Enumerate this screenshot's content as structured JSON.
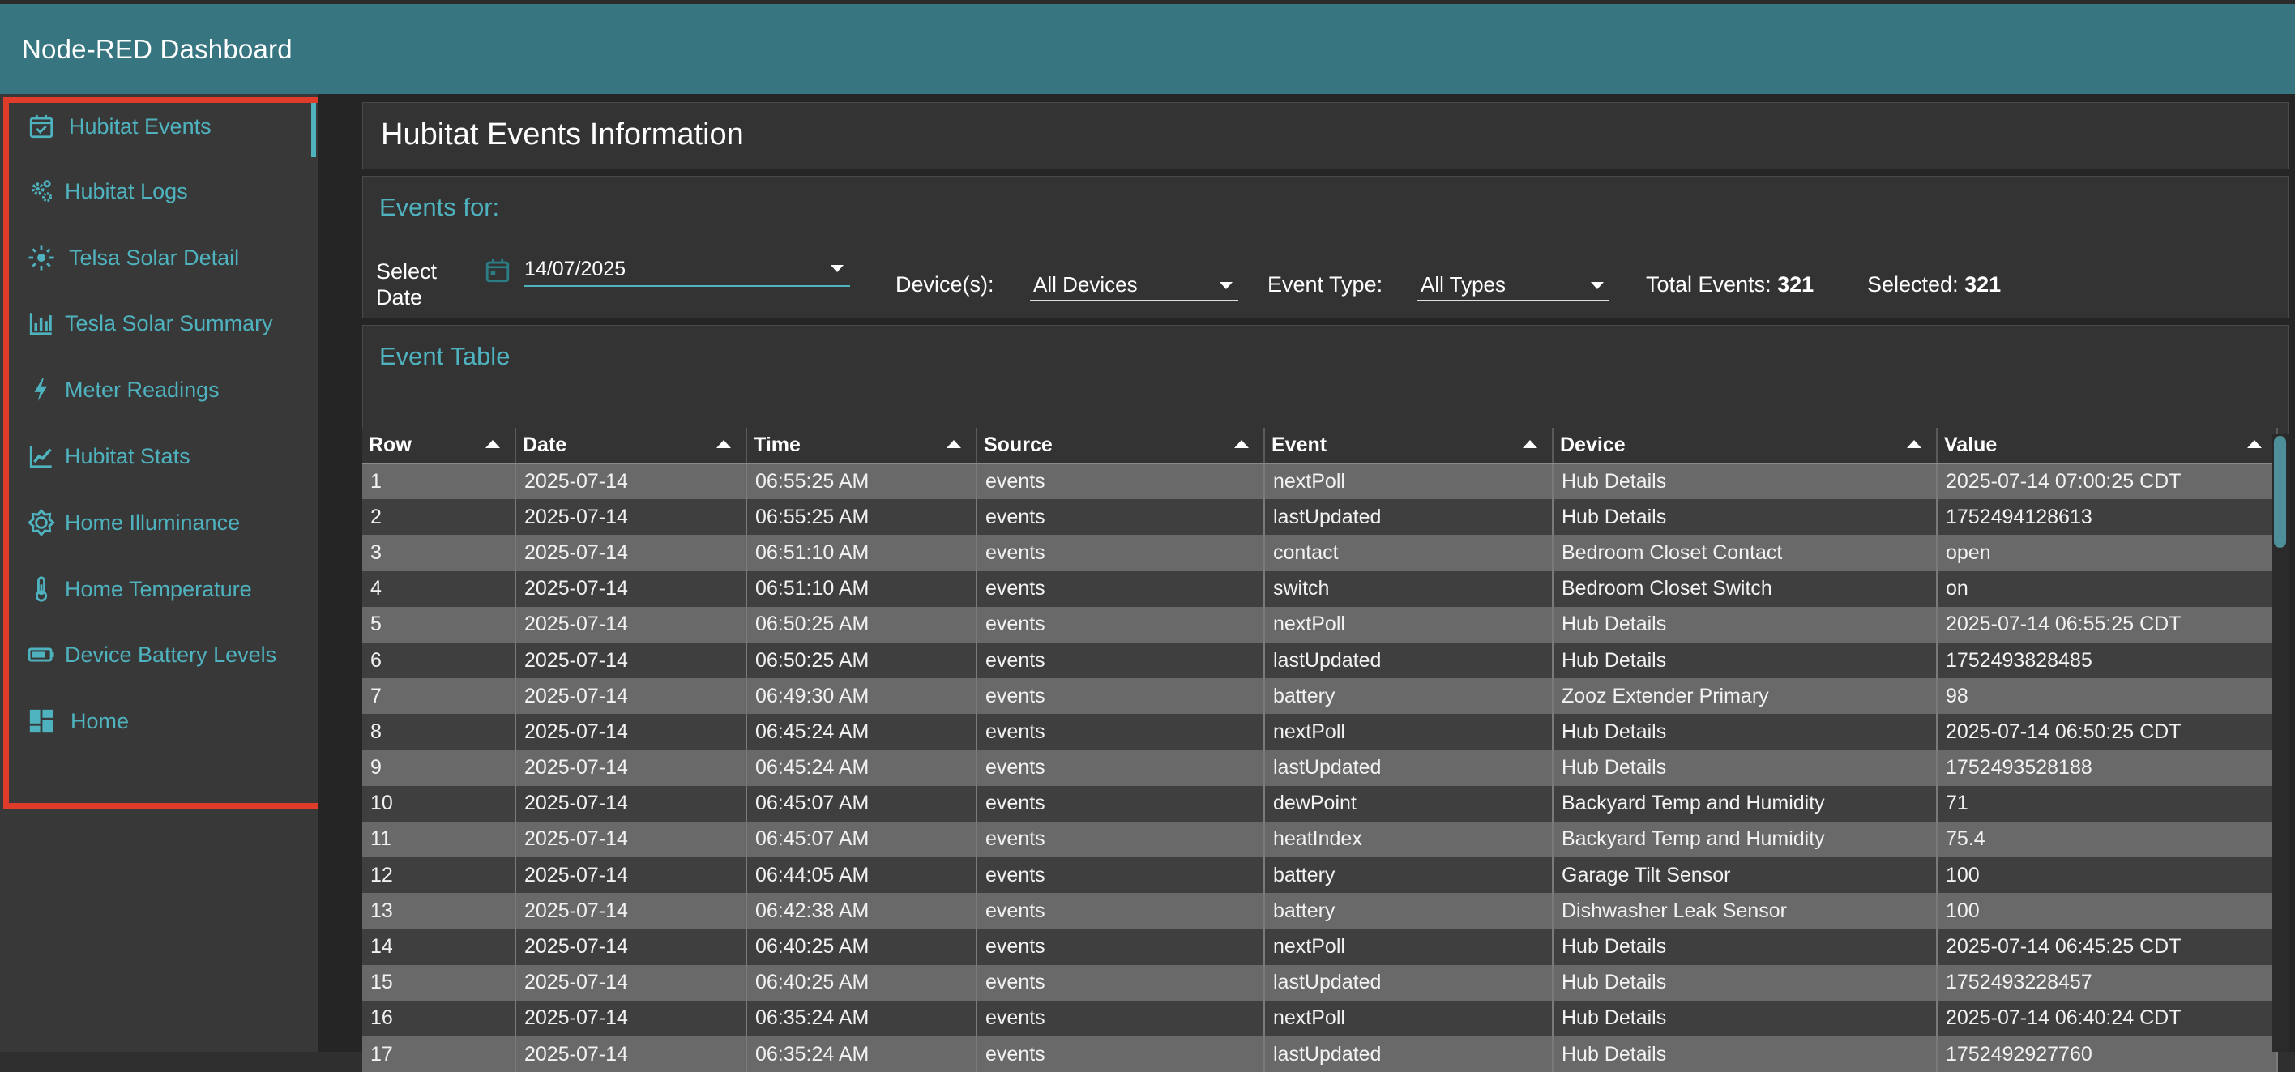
{
  "app": {
    "title": "Node-RED Dashboard"
  },
  "sidebar": {
    "items": [
      {
        "label": "Hubitat Events",
        "icon": "calendar-check-icon",
        "active": true
      },
      {
        "label": "Hubitat Logs",
        "icon": "gears-icon"
      },
      {
        "label": "Telsa Solar Detail",
        "icon": "sun-icon"
      },
      {
        "label": "Tesla Solar Summary",
        "icon": "bar-chart-icon"
      },
      {
        "label": "Meter Readings",
        "icon": "lightning-icon"
      },
      {
        "label": "Hubitat Stats",
        "icon": "line-chart-icon"
      },
      {
        "label": "Home Illuminance",
        "icon": "brightness-icon"
      },
      {
        "label": "Home Temperature",
        "icon": "thermometer-icon"
      },
      {
        "label": "Device Battery Levels",
        "icon": "battery-icon"
      },
      {
        "label": "Home",
        "icon": "dashboard-icon"
      }
    ]
  },
  "header_card": {
    "title": "Hubitat Events Information"
  },
  "filters": {
    "title": "Events for:",
    "date_label_line1": "Select",
    "date_label_line2": "Date",
    "date_value": "14/07/2025",
    "devices_label": "Device(s):",
    "devices_value": "All Devices",
    "event_type_label": "Event Type:",
    "event_type_value": "All Types",
    "total_label": "Total Events:",
    "total_value": "321",
    "selected_label": "Selected:",
    "selected_value": "321"
  },
  "table": {
    "title": "Event Table",
    "columns": [
      "Row",
      "Date",
      "Time",
      "Source",
      "Event",
      "Device",
      "Value"
    ],
    "rows": [
      [
        "1",
        "2025-07-14",
        "06:55:25 AM",
        "events",
        "nextPoll",
        "Hub Details",
        "2025-07-14 07:00:25 CDT"
      ],
      [
        "2",
        "2025-07-14",
        "06:55:25 AM",
        "events",
        "lastUpdated",
        "Hub Details",
        "1752494128613"
      ],
      [
        "3",
        "2025-07-14",
        "06:51:10 AM",
        "events",
        "contact",
        "Bedroom Closet Contact",
        "open"
      ],
      [
        "4",
        "2025-07-14",
        "06:51:10 AM",
        "events",
        "switch",
        "Bedroom Closet Switch",
        "on"
      ],
      [
        "5",
        "2025-07-14",
        "06:50:25 AM",
        "events",
        "nextPoll",
        "Hub Details",
        "2025-07-14 06:55:25 CDT"
      ],
      [
        "6",
        "2025-07-14",
        "06:50:25 AM",
        "events",
        "lastUpdated",
        "Hub Details",
        "1752493828485"
      ],
      [
        "7",
        "2025-07-14",
        "06:49:30 AM",
        "events",
        "battery",
        "Zooz Extender Primary",
        "98"
      ],
      [
        "8",
        "2025-07-14",
        "06:45:24 AM",
        "events",
        "nextPoll",
        "Hub Details",
        "2025-07-14 06:50:25 CDT"
      ],
      [
        "9",
        "2025-07-14",
        "06:45:24 AM",
        "events",
        "lastUpdated",
        "Hub Details",
        "1752493528188"
      ],
      [
        "10",
        "2025-07-14",
        "06:45:07 AM",
        "events",
        "dewPoint",
        "Backyard Temp and Humidity",
        "71"
      ],
      [
        "11",
        "2025-07-14",
        "06:45:07 AM",
        "events",
        "heatIndex",
        "Backyard Temp and Humidity",
        "75.4"
      ],
      [
        "12",
        "2025-07-14",
        "06:44:05 AM",
        "events",
        "battery",
        "Garage Tilt Sensor",
        "100"
      ],
      [
        "13",
        "2025-07-14",
        "06:42:38 AM",
        "events",
        "battery",
        "Dishwasher Leak Sensor",
        "100"
      ],
      [
        "14",
        "2025-07-14",
        "06:40:25 AM",
        "events",
        "nextPoll",
        "Hub Details",
        "2025-07-14 06:45:25 CDT"
      ],
      [
        "15",
        "2025-07-14",
        "06:40:25 AM",
        "events",
        "lastUpdated",
        "Hub Details",
        "1752493228457"
      ],
      [
        "16",
        "2025-07-14",
        "06:35:24 AM",
        "events",
        "nextPoll",
        "Hub Details",
        "2025-07-14 06:40:24 CDT"
      ],
      [
        "17",
        "2025-07-14",
        "06:35:24 AM",
        "events",
        "lastUpdated",
        "Hub Details",
        "1752492927760"
      ]
    ]
  },
  "colors": {
    "accent": "#4fb3bf",
    "topbar": "#377681",
    "highlight": "#e03c2c"
  }
}
